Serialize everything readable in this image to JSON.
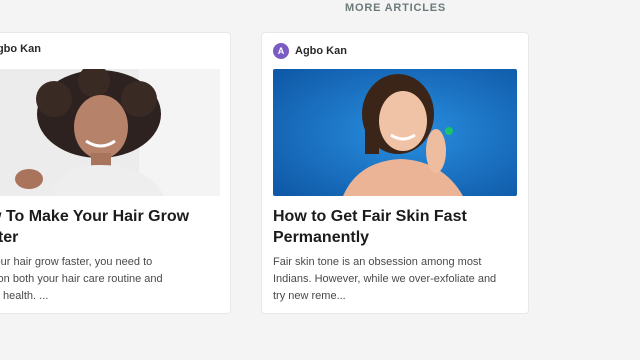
{
  "section": {
    "title": "MORE ARTICLES"
  },
  "articles": [
    {
      "author": "Agbo Kan",
      "avatar_initial": "",
      "title_lines": [
        "w To Make Your Hair Grow",
        "ster"
      ],
      "excerpt_lines": [
        "your hair grow faster, you need to",
        "s on both your hair care routine and",
        "all health. ..."
      ],
      "image": "woman-curly-hair-photo"
    },
    {
      "author": "Agbo Kan",
      "avatar_initial": "A",
      "title_lines": [
        "How to Get Fair Skin Fast",
        "Permanently"
      ],
      "excerpt_lines": [
        "Fair skin tone is an obsession among most",
        "Indians. However, while we over-exfoliate and",
        "try new reme..."
      ],
      "image": "woman-blue-background-photo"
    }
  ],
  "colors": {
    "accent": "#7b5cc2",
    "photo_blue": "#1a72c4"
  }
}
